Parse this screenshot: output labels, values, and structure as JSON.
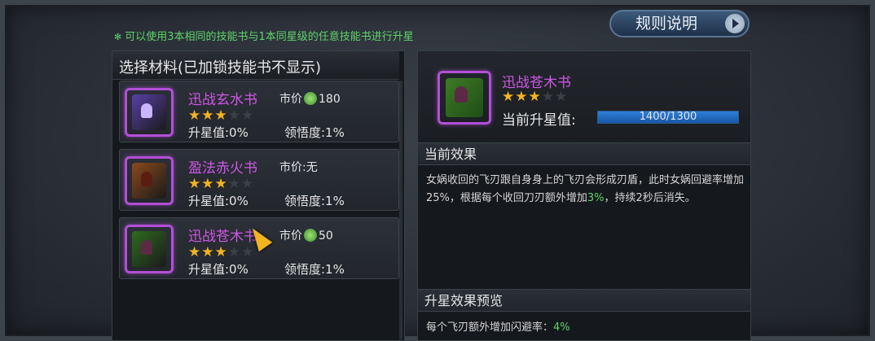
{
  "hint": "可以使用3本相同的技能书与1本同星级的任意技能书进行升星",
  "rules_button": "规则说明",
  "left_title": "选择材料(已加锁技能书不显示)",
  "materials": [
    {
      "name": "迅战玄水书",
      "stars": 3,
      "max_stars": 5,
      "price_label": "市价",
      "price": "180",
      "has_coin": true,
      "star_value": "升星值:0%",
      "comprehension": "领悟度:1%",
      "cover_color": "#5a3fa8"
    },
    {
      "name": "盈法赤火书",
      "stars": 3,
      "max_stars": 5,
      "price_label": "市价:无",
      "price": "",
      "has_coin": false,
      "star_value": "升星值:0%",
      "comprehension": "领悟度:1%",
      "cover_color": "#8a4a1c"
    },
    {
      "name": "迅战苍木书",
      "stars": 3,
      "max_stars": 5,
      "price_label": "市价",
      "price": "50",
      "has_coin": true,
      "star_value": "升星值:0%",
      "comprehension": "领悟度:1%",
      "cover_color": "#2f6b20"
    }
  ],
  "selected": {
    "name": "迅战苍木书",
    "stars": 3,
    "max_stars": 5,
    "star_label": "当前升星值:",
    "progress_text": "1400/1300",
    "progress_fraction": 1.0
  },
  "current_effect_title": "当前效果",
  "effect_parts": {
    "a": "女娲收回的飞刃跟自身身上的飞刃会形成刃盾，此时女娲回避率增加25%，根据每个收回刀刃额外增加",
    "b": "3%",
    "c": "，持续2秒后消失。"
  },
  "preview_title": "升星效果预览",
  "preview_parts": {
    "a": "每个飞刃额外增加闪避率：",
    "b": "4%"
  },
  "colors": {
    "accent_purple": "#cf57e6",
    "hint_green": "#5fd36a",
    "star_gold": "#f4b321",
    "bar_blue": "#2f7fd8"
  }
}
